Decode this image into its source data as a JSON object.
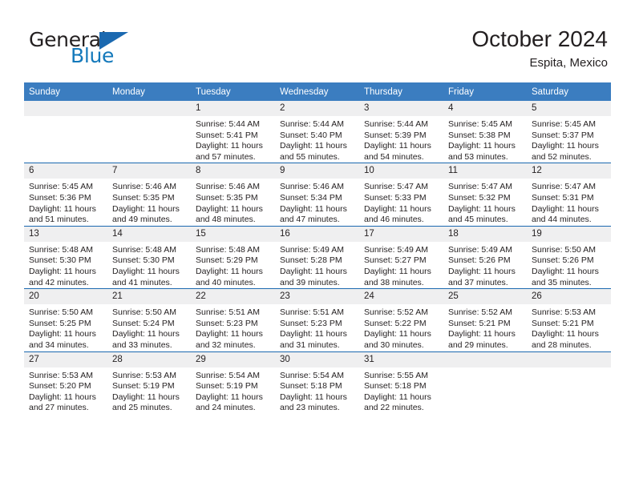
{
  "logo": {
    "primary": "General",
    "secondary": "Blue",
    "triangle_color": "#1b69b0",
    "primary_color": "#231f20",
    "secondary_color": "#1479bb"
  },
  "header": {
    "title": "October 2024",
    "subtitle": "Espita, Mexico"
  },
  "theme": {
    "header_bg": "#3b7dc0",
    "header_text": "#ffffff",
    "daynum_bg": "#efeff0",
    "row_separator": "#1b69b0",
    "body_text": "#231f20"
  },
  "weekday_headers": [
    "Sunday",
    "Monday",
    "Tuesday",
    "Wednesday",
    "Thursday",
    "Friday",
    "Saturday"
  ],
  "labels": {
    "sunrise_prefix": "Sunrise:",
    "sunset_prefix": "Sunset:",
    "daylight_prefix": "Daylight:"
  },
  "weeks": [
    [
      {
        "day": "",
        "sunrise": "",
        "sunset": "",
        "daylight_line1": "",
        "daylight_line2": ""
      },
      {
        "day": "",
        "sunrise": "",
        "sunset": "",
        "daylight_line1": "",
        "daylight_line2": ""
      },
      {
        "day": "1",
        "sunrise": "Sunrise: 5:44 AM",
        "sunset": "Sunset: 5:41 PM",
        "daylight_line1": "Daylight: 11 hours",
        "daylight_line2": "and 57 minutes."
      },
      {
        "day": "2",
        "sunrise": "Sunrise: 5:44 AM",
        "sunset": "Sunset: 5:40 PM",
        "daylight_line1": "Daylight: 11 hours",
        "daylight_line2": "and 55 minutes."
      },
      {
        "day": "3",
        "sunrise": "Sunrise: 5:44 AM",
        "sunset": "Sunset: 5:39 PM",
        "daylight_line1": "Daylight: 11 hours",
        "daylight_line2": "and 54 minutes."
      },
      {
        "day": "4",
        "sunrise": "Sunrise: 5:45 AM",
        "sunset": "Sunset: 5:38 PM",
        "daylight_line1": "Daylight: 11 hours",
        "daylight_line2": "and 53 minutes."
      },
      {
        "day": "5",
        "sunrise": "Sunrise: 5:45 AM",
        "sunset": "Sunset: 5:37 PM",
        "daylight_line1": "Daylight: 11 hours",
        "daylight_line2": "and 52 minutes."
      }
    ],
    [
      {
        "day": "6",
        "sunrise": "Sunrise: 5:45 AM",
        "sunset": "Sunset: 5:36 PM",
        "daylight_line1": "Daylight: 11 hours",
        "daylight_line2": "and 51 minutes."
      },
      {
        "day": "7",
        "sunrise": "Sunrise: 5:46 AM",
        "sunset": "Sunset: 5:35 PM",
        "daylight_line1": "Daylight: 11 hours",
        "daylight_line2": "and 49 minutes."
      },
      {
        "day": "8",
        "sunrise": "Sunrise: 5:46 AM",
        "sunset": "Sunset: 5:35 PM",
        "daylight_line1": "Daylight: 11 hours",
        "daylight_line2": "and 48 minutes."
      },
      {
        "day": "9",
        "sunrise": "Sunrise: 5:46 AM",
        "sunset": "Sunset: 5:34 PM",
        "daylight_line1": "Daylight: 11 hours",
        "daylight_line2": "and 47 minutes."
      },
      {
        "day": "10",
        "sunrise": "Sunrise: 5:47 AM",
        "sunset": "Sunset: 5:33 PM",
        "daylight_line1": "Daylight: 11 hours",
        "daylight_line2": "and 46 minutes."
      },
      {
        "day": "11",
        "sunrise": "Sunrise: 5:47 AM",
        "sunset": "Sunset: 5:32 PM",
        "daylight_line1": "Daylight: 11 hours",
        "daylight_line2": "and 45 minutes."
      },
      {
        "day": "12",
        "sunrise": "Sunrise: 5:47 AM",
        "sunset": "Sunset: 5:31 PM",
        "daylight_line1": "Daylight: 11 hours",
        "daylight_line2": "and 44 minutes."
      }
    ],
    [
      {
        "day": "13",
        "sunrise": "Sunrise: 5:48 AM",
        "sunset": "Sunset: 5:30 PM",
        "daylight_line1": "Daylight: 11 hours",
        "daylight_line2": "and 42 minutes."
      },
      {
        "day": "14",
        "sunrise": "Sunrise: 5:48 AM",
        "sunset": "Sunset: 5:30 PM",
        "daylight_line1": "Daylight: 11 hours",
        "daylight_line2": "and 41 minutes."
      },
      {
        "day": "15",
        "sunrise": "Sunrise: 5:48 AM",
        "sunset": "Sunset: 5:29 PM",
        "daylight_line1": "Daylight: 11 hours",
        "daylight_line2": "and 40 minutes."
      },
      {
        "day": "16",
        "sunrise": "Sunrise: 5:49 AM",
        "sunset": "Sunset: 5:28 PM",
        "daylight_line1": "Daylight: 11 hours",
        "daylight_line2": "and 39 minutes."
      },
      {
        "day": "17",
        "sunrise": "Sunrise: 5:49 AM",
        "sunset": "Sunset: 5:27 PM",
        "daylight_line1": "Daylight: 11 hours",
        "daylight_line2": "and 38 minutes."
      },
      {
        "day": "18",
        "sunrise": "Sunrise: 5:49 AM",
        "sunset": "Sunset: 5:26 PM",
        "daylight_line1": "Daylight: 11 hours",
        "daylight_line2": "and 37 minutes."
      },
      {
        "day": "19",
        "sunrise": "Sunrise: 5:50 AM",
        "sunset": "Sunset: 5:26 PM",
        "daylight_line1": "Daylight: 11 hours",
        "daylight_line2": "and 35 minutes."
      }
    ],
    [
      {
        "day": "20",
        "sunrise": "Sunrise: 5:50 AM",
        "sunset": "Sunset: 5:25 PM",
        "daylight_line1": "Daylight: 11 hours",
        "daylight_line2": "and 34 minutes."
      },
      {
        "day": "21",
        "sunrise": "Sunrise: 5:50 AM",
        "sunset": "Sunset: 5:24 PM",
        "daylight_line1": "Daylight: 11 hours",
        "daylight_line2": "and 33 minutes."
      },
      {
        "day": "22",
        "sunrise": "Sunrise: 5:51 AM",
        "sunset": "Sunset: 5:23 PM",
        "daylight_line1": "Daylight: 11 hours",
        "daylight_line2": "and 32 minutes."
      },
      {
        "day": "23",
        "sunrise": "Sunrise: 5:51 AM",
        "sunset": "Sunset: 5:23 PM",
        "daylight_line1": "Daylight: 11 hours",
        "daylight_line2": "and 31 minutes."
      },
      {
        "day": "24",
        "sunrise": "Sunrise: 5:52 AM",
        "sunset": "Sunset: 5:22 PM",
        "daylight_line1": "Daylight: 11 hours",
        "daylight_line2": "and 30 minutes."
      },
      {
        "day": "25",
        "sunrise": "Sunrise: 5:52 AM",
        "sunset": "Sunset: 5:21 PM",
        "daylight_line1": "Daylight: 11 hours",
        "daylight_line2": "and 29 minutes."
      },
      {
        "day": "26",
        "sunrise": "Sunrise: 5:53 AM",
        "sunset": "Sunset: 5:21 PM",
        "daylight_line1": "Daylight: 11 hours",
        "daylight_line2": "and 28 minutes."
      }
    ],
    [
      {
        "day": "27",
        "sunrise": "Sunrise: 5:53 AM",
        "sunset": "Sunset: 5:20 PM",
        "daylight_line1": "Daylight: 11 hours",
        "daylight_line2": "and 27 minutes."
      },
      {
        "day": "28",
        "sunrise": "Sunrise: 5:53 AM",
        "sunset": "Sunset: 5:19 PM",
        "daylight_line1": "Daylight: 11 hours",
        "daylight_line2": "and 25 minutes."
      },
      {
        "day": "29",
        "sunrise": "Sunrise: 5:54 AM",
        "sunset": "Sunset: 5:19 PM",
        "daylight_line1": "Daylight: 11 hours",
        "daylight_line2": "and 24 minutes."
      },
      {
        "day": "30",
        "sunrise": "Sunrise: 5:54 AM",
        "sunset": "Sunset: 5:18 PM",
        "daylight_line1": "Daylight: 11 hours",
        "daylight_line2": "and 23 minutes."
      },
      {
        "day": "31",
        "sunrise": "Sunrise: 5:55 AM",
        "sunset": "Sunset: 5:18 PM",
        "daylight_line1": "Daylight: 11 hours",
        "daylight_line2": "and 22 minutes."
      },
      {
        "day": "",
        "sunrise": "",
        "sunset": "",
        "daylight_line1": "",
        "daylight_line2": ""
      },
      {
        "day": "",
        "sunrise": "",
        "sunset": "",
        "daylight_line1": "",
        "daylight_line2": ""
      }
    ]
  ]
}
